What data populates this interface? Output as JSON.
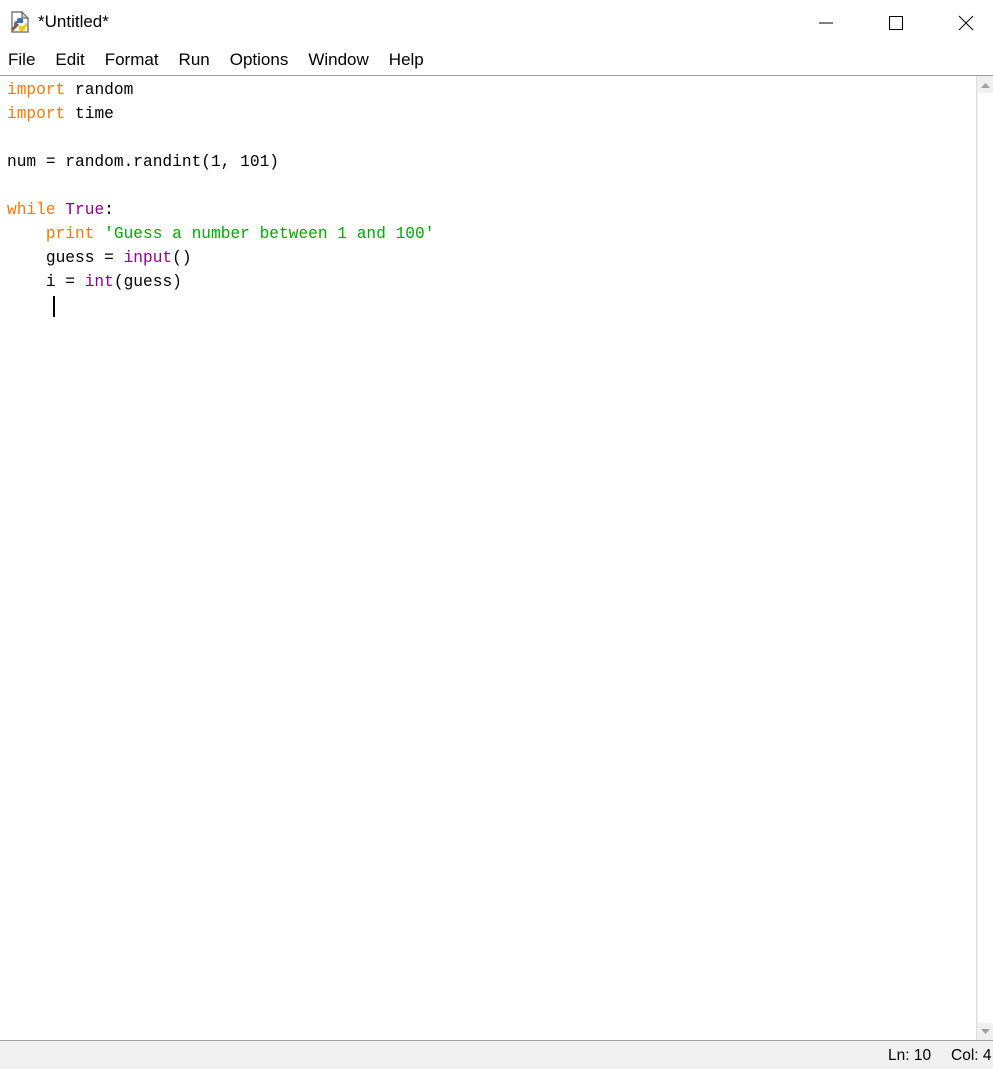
{
  "window": {
    "title": "*Untitled*",
    "icon": "python-idle-file-icon",
    "controls": [
      "minimize-icon",
      "maximize-icon",
      "close-icon"
    ]
  },
  "menu": [
    "File",
    "Edit",
    "Format",
    "Run",
    "Options",
    "Window",
    "Help"
  ],
  "editor": {
    "lines": [
      [
        {
          "t": "import",
          "c": "kw"
        },
        {
          "t": " random",
          "c": ""
        }
      ],
      [
        {
          "t": "import",
          "c": "kw"
        },
        {
          "t": " time",
          "c": ""
        }
      ],
      [],
      [
        {
          "t": "num = random.randint(1, 101)",
          "c": ""
        }
      ],
      [],
      [
        {
          "t": "while",
          "c": "kw"
        },
        {
          "t": " ",
          "c": ""
        },
        {
          "t": "True",
          "c": "bi"
        },
        {
          "t": ":",
          "c": ""
        }
      ],
      [
        {
          "t": "    ",
          "c": ""
        },
        {
          "t": "print",
          "c": "kw"
        },
        {
          "t": " ",
          "c": ""
        },
        {
          "t": "'Guess a number between 1 and 100'",
          "c": "st"
        }
      ],
      [
        {
          "t": "    guess = ",
          "c": ""
        },
        {
          "t": "input",
          "c": "bi"
        },
        {
          "t": "()",
          "c": ""
        }
      ],
      [
        {
          "t": "    i = ",
          "c": ""
        },
        {
          "t": "int",
          "c": "bi"
        },
        {
          "t": "(guess)",
          "c": ""
        }
      ],
      [
        {
          "t": "    ",
          "c": ""
        }
      ]
    ],
    "colors": {
      "keyword": "#ff7700",
      "builtin": "#900090",
      "string": "#00aa00"
    }
  },
  "status": {
    "ln": "Ln: 10",
    "col": "Col: 4"
  }
}
